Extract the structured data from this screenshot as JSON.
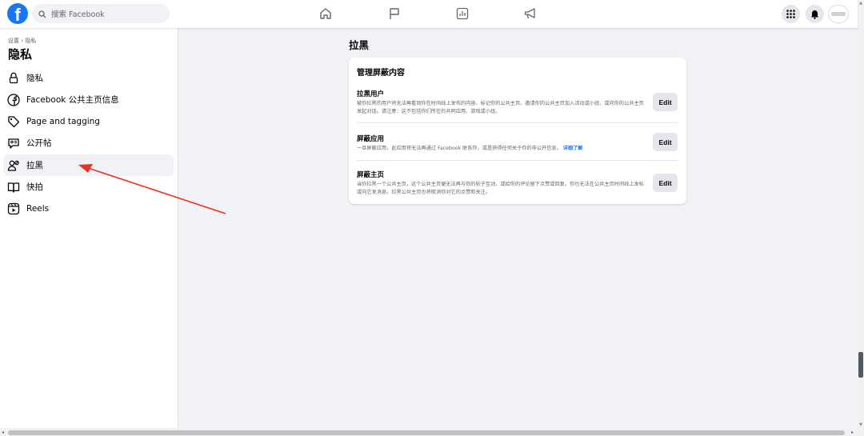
{
  "topbar": {
    "logo": "f",
    "search_placeholder": "搜索 Facebook",
    "nav_icons": [
      "home-icon",
      "flag-icon",
      "chart-icon",
      "megaphone-icon"
    ],
    "right_icons": [
      "menu-grid-icon",
      "bell-icon",
      "avatar"
    ]
  },
  "sidebar": {
    "breadcrumb": "设置 › 隐私",
    "title": "隐私",
    "items": [
      {
        "label": "隐私",
        "icon": "lock-icon"
      },
      {
        "label": "Facebook 公共主页信息",
        "icon": "facebook-icon"
      },
      {
        "label": "Page and tagging",
        "icon": "tag-icon"
      },
      {
        "label": "公开帖",
        "icon": "post-icon"
      },
      {
        "label": "拉黑",
        "icon": "block-user-icon",
        "active": true
      },
      {
        "label": "快拍",
        "icon": "book-icon"
      },
      {
        "label": "Reels",
        "icon": "reels-icon"
      }
    ]
  },
  "main": {
    "title": "拉黑",
    "card": {
      "title": "管理屏蔽内容",
      "sections": [
        {
          "title": "拉黑用户",
          "desc": "被你拉黑的用户将无法再看到你在时间线上发布的内容、标记你的公共主页、邀请你的公共主页加入活动或小组，或向你的公共主页发起对话。请注意：这不包括你们所在的共同应用、游戏或小组。",
          "button": "Edit"
        },
        {
          "title": "屏蔽应用",
          "desc": "一旦屏蔽应用，此应用将无法再通过 Facebook 联系你，或是获得任何关于你的非公开信息。",
          "link": "详细了解",
          "button": "Edit"
        },
        {
          "title": "屏蔽主页",
          "desc": "当你拉黑一个公共主页，这个公共主页便无法再与你的帖子互动，或给你的评论留下点赞或回复。你也无法在公共主页时间线上发帖或向它发消息。拉黑公共主页也将取消你对它的点赞和关注。",
          "button": "Edit"
        }
      ]
    }
  },
  "colors": {
    "brand": "#1877f2",
    "annotation_arrow": "#e8322a"
  }
}
